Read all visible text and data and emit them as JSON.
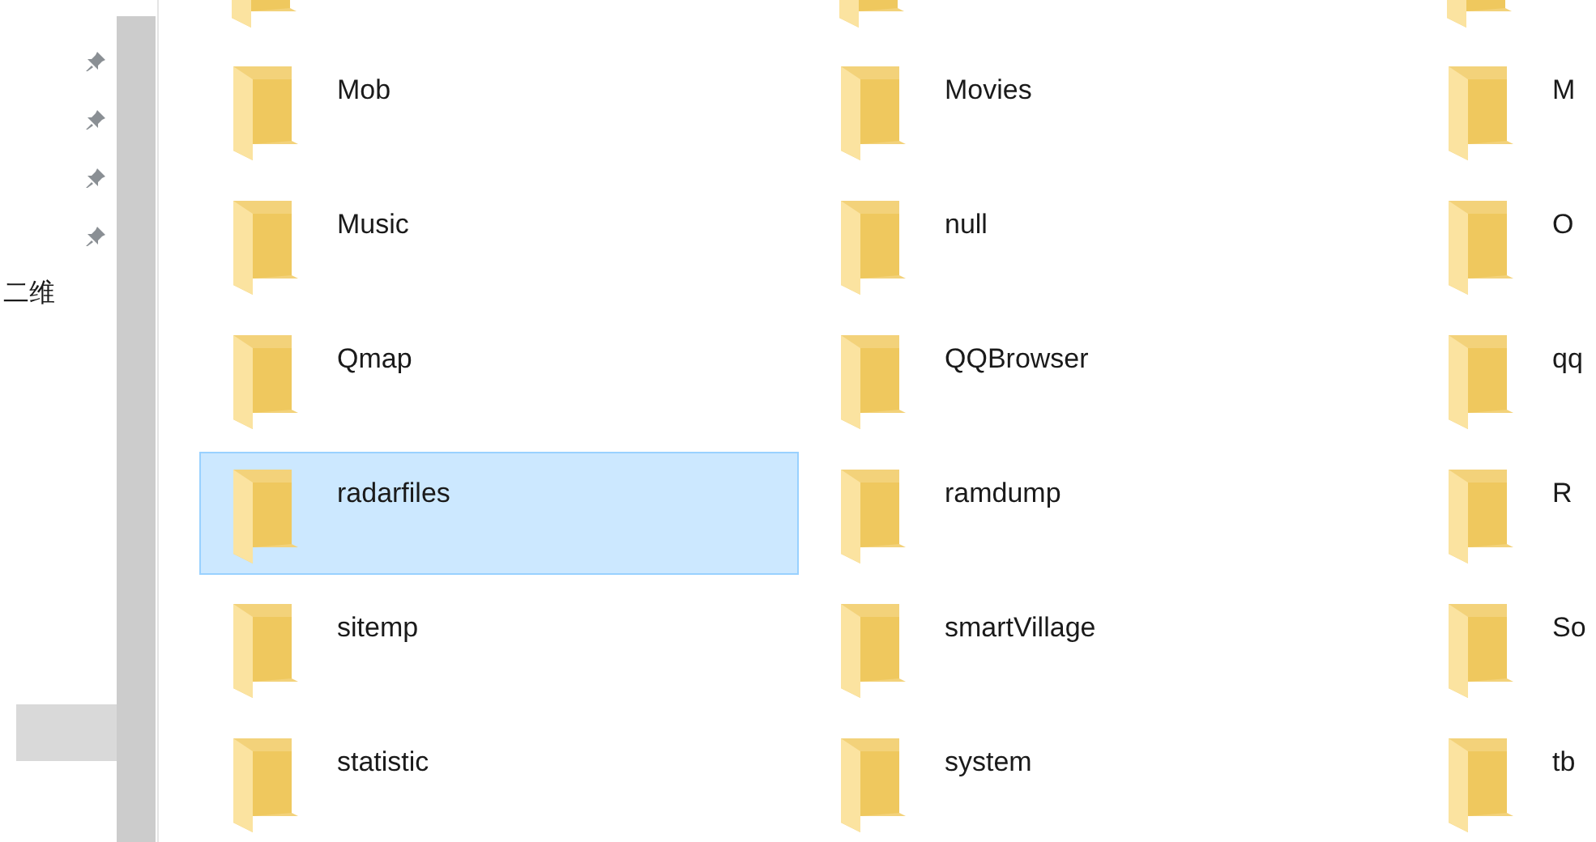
{
  "sidebar": {
    "items": [
      {
        "kind": "pinned",
        "pinned": true,
        "selected": false
      },
      {
        "kind": "pinned",
        "pinned": true,
        "selected": false
      },
      {
        "kind": "pinned",
        "pinned": true,
        "selected": false
      },
      {
        "kind": "pinned",
        "pinned": true,
        "selected": false
      },
      {
        "kind": "label",
        "label": "二维",
        "selected": false
      },
      {
        "kind": "blank",
        "selected": true
      }
    ]
  },
  "folders": [
    [
      {
        "name": "Mob",
        "selected": false
      },
      {
        "name": "Movies",
        "selected": false
      },
      {
        "name": "M",
        "selected": false
      }
    ],
    [
      {
        "name": "Music",
        "selected": false
      },
      {
        "name": "null",
        "selected": false
      },
      {
        "name": "O",
        "selected": false
      }
    ],
    [
      {
        "name": "Qmap",
        "selected": false
      },
      {
        "name": "QQBrowser",
        "selected": false
      },
      {
        "name": "qq",
        "selected": false
      }
    ],
    [
      {
        "name": "radarfiles",
        "selected": true
      },
      {
        "name": "ramdump",
        "selected": false
      },
      {
        "name": "R",
        "selected": false
      }
    ],
    [
      {
        "name": "sitemp",
        "selected": false
      },
      {
        "name": "smartVillage",
        "selected": false
      },
      {
        "name": "So",
        "selected": false
      }
    ],
    [
      {
        "name": "statistic",
        "selected": false
      },
      {
        "name": "system",
        "selected": false
      },
      {
        "name": "tb",
        "selected": false
      }
    ]
  ]
}
